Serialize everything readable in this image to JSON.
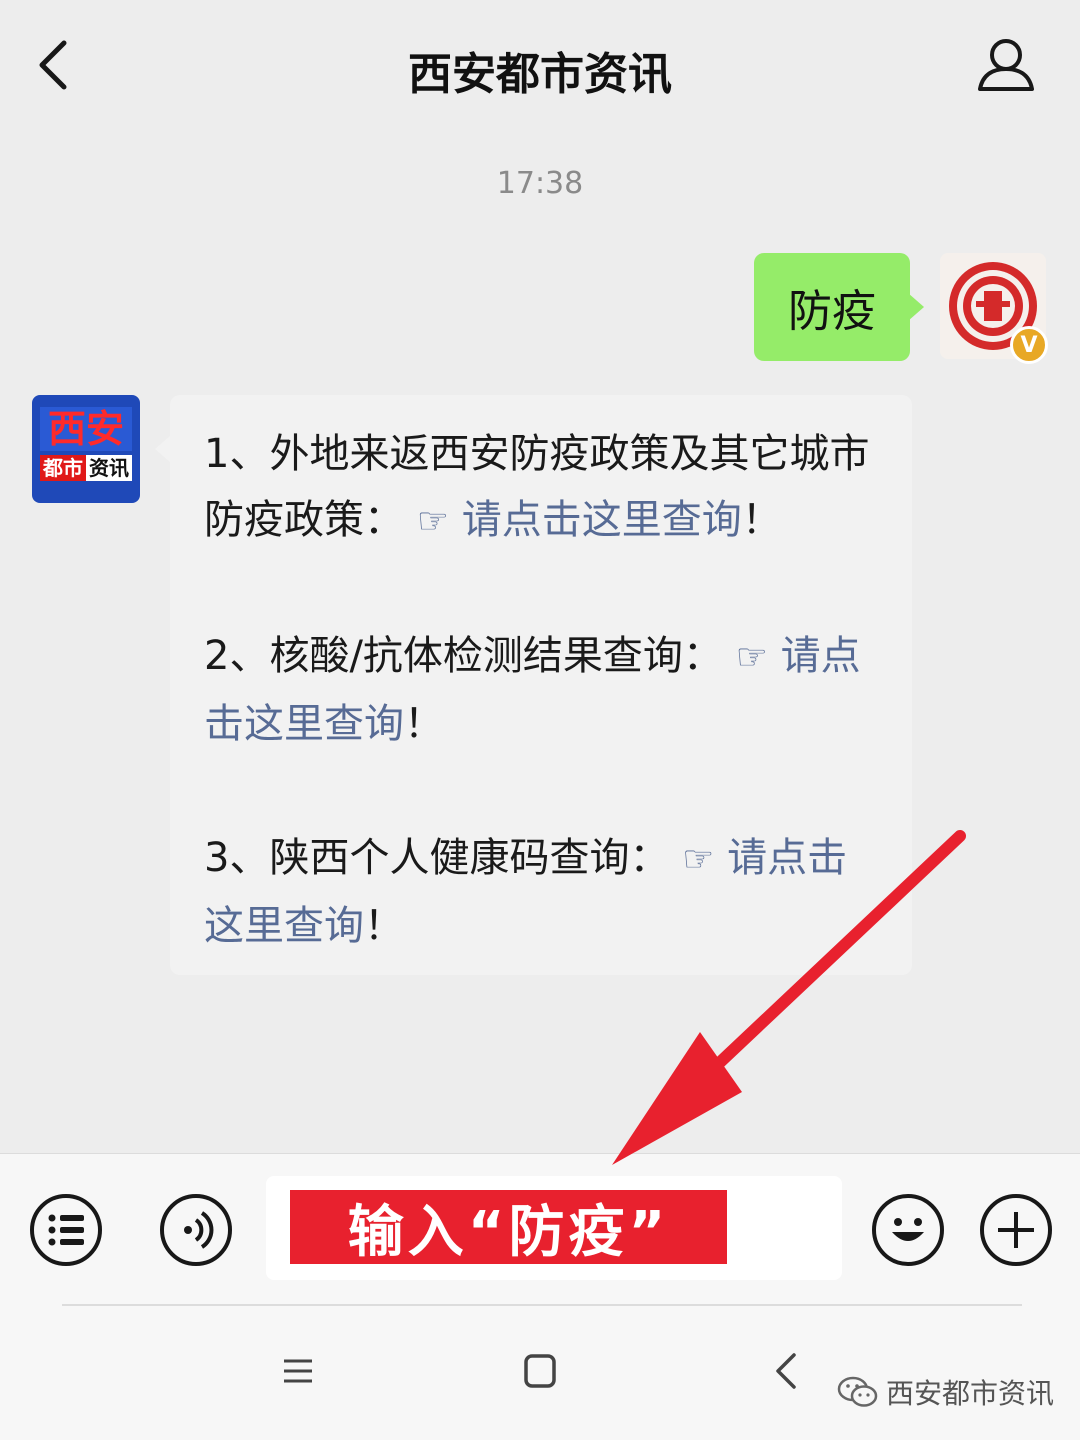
{
  "header": {
    "title": "西安都市资讯",
    "back_icon": "chevron-left-icon",
    "profile_icon": "person-icon"
  },
  "chat": {
    "timestamp": "17:38",
    "sent_message": "防疫",
    "verify_badge": "V",
    "bot_avatar": {
      "top_text": "西安",
      "bottom_left": "都市",
      "bottom_right": "资讯"
    },
    "received_message": {
      "items": [
        {
          "prefix": "1、外地来返西安防疫政策及其它城市防疫政策：",
          "hand": "☞",
          "link": "请点击这里查询",
          "suffix": "！"
        },
        {
          "prefix": "2、核酸/抗体检测结果查询：",
          "hand": "☞",
          "link": "请点击这里查询",
          "suffix": "！"
        },
        {
          "prefix": "3、陕西个人健康码查询：",
          "hand": "☞",
          "link": "请点击这里查询",
          "suffix": "！"
        }
      ]
    }
  },
  "input_bar": {
    "banner_text": "输入“防疫”",
    "menu_icon": "list-menu-icon",
    "voice_icon": "voice-icon",
    "emoji_icon": "emoji-icon",
    "plus_icon": "plus-icon"
  },
  "watermark": {
    "text": "西安都市资讯"
  },
  "colors": {
    "sent_bubble": "#95ec69",
    "link": "#576b95",
    "banner": "#e8212e",
    "arrow": "#e8212e"
  }
}
